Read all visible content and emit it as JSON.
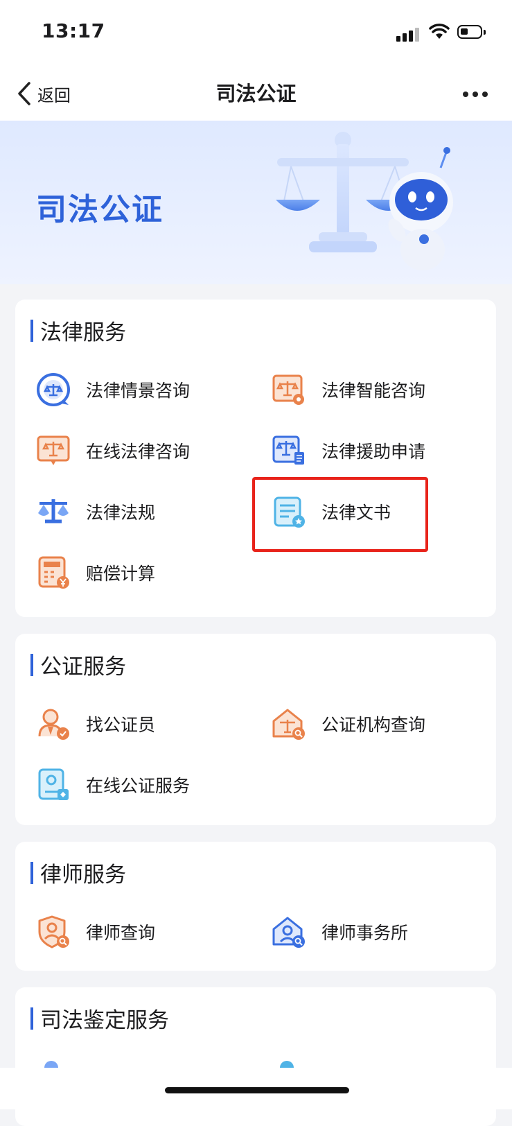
{
  "status": {
    "time": "13:17"
  },
  "nav": {
    "back_label": "返回",
    "title": "司法公证"
  },
  "banner": {
    "title": "司法公证"
  },
  "sections": [
    {
      "title": "法律服务",
      "items": [
        {
          "label": "法律情景咨询",
          "icon": "scale-chat-icon"
        },
        {
          "label": "法律智能咨询",
          "icon": "scale-gear-icon"
        },
        {
          "label": "在线法律咨询",
          "icon": "scale-board-icon"
        },
        {
          "label": "法律援助申请",
          "icon": "scale-doc-icon"
        },
        {
          "label": "法律法规",
          "icon": "scale-icon"
        },
        {
          "label": "法律文书",
          "icon": "document-star-icon"
        },
        {
          "label": "赔偿计算",
          "icon": "calculator-yen-icon"
        }
      ]
    },
    {
      "title": "公证服务",
      "items": [
        {
          "label": "找公证员",
          "icon": "notary-person-icon"
        },
        {
          "label": "公证机构查询",
          "icon": "institution-search-icon"
        },
        {
          "label": "在线公证服务",
          "icon": "online-notary-icon"
        }
      ]
    },
    {
      "title": "律师服务",
      "items": [
        {
          "label": "律师查询",
          "icon": "lawyer-search-icon"
        },
        {
          "label": "律师事务所",
          "icon": "law-firm-icon"
        }
      ]
    },
    {
      "title": "司法鉴定服务",
      "items": []
    }
  ],
  "colors": {
    "accent": "#2e62d9",
    "highlight": "#e8231a",
    "orange": "#e9824b",
    "blue": "#3a6fe0",
    "teal": "#4fb3e6"
  }
}
